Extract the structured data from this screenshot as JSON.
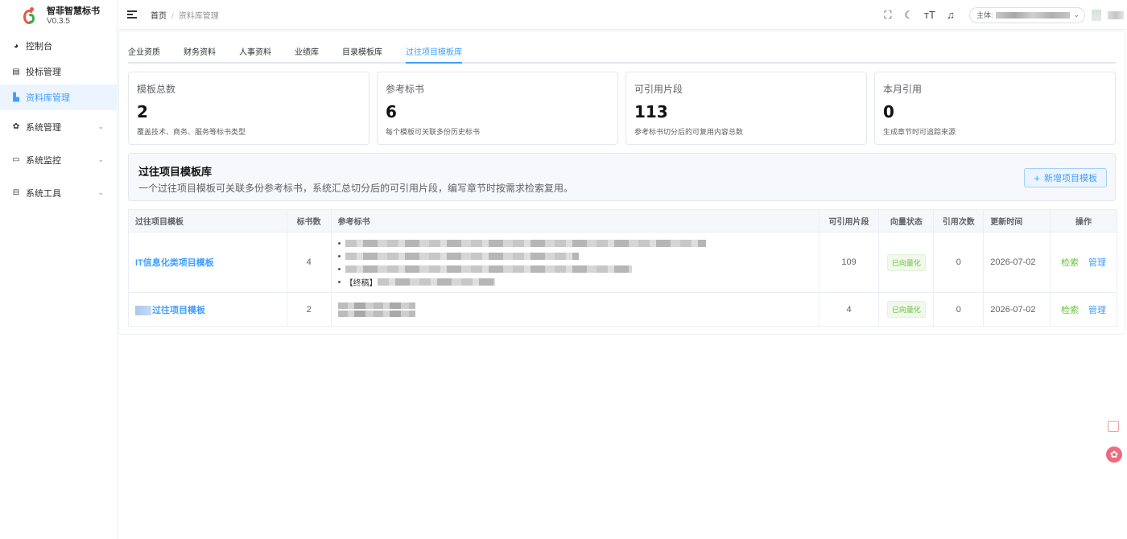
{
  "brand": {
    "name": "智菲智慧标书",
    "version": "V0.3.5"
  },
  "sidebar": {
    "items": [
      {
        "label": "控制台",
        "icon": "dashboard-icon"
      },
      {
        "label": "投标管理",
        "icon": "document-icon"
      },
      {
        "label": "资料库管理",
        "icon": "library-icon",
        "active": true
      },
      {
        "label": "系统管理",
        "icon": "gear-icon"
      },
      {
        "label": "系统监控",
        "icon": "monitor-icon"
      },
      {
        "label": "系统工具",
        "icon": "toolbox-icon"
      }
    ]
  },
  "breadcrumb": {
    "home": "首页",
    "separator": "/",
    "current": "资料库管理"
  },
  "topbar": {
    "entity_label": "主体:"
  },
  "tabs": [
    "企业资质",
    "财务资料",
    "人事资料",
    "业绩库",
    "目录模板库",
    "过往项目模板库"
  ],
  "stats": [
    {
      "label": "模板总数",
      "value": "2",
      "desc": "覆盖技术、商务、服务等标书类型"
    },
    {
      "label": "参考标书",
      "value": "6",
      "desc": "每个模板可关联多份历史标书"
    },
    {
      "label": "可引用片段",
      "value": "113",
      "desc": "参考标书切分后的可复用内容总数"
    },
    {
      "label": "本月引用",
      "value": "0",
      "desc": "生成章节时可追踪来源"
    }
  ],
  "banner": {
    "title": "过往项目模板库",
    "subtitle": "一个过往项目模板可关联多份参考标书，系统汇总切分后的可引用片段，编写章节时按需求检索复用。",
    "add_button": "新增项目模板"
  },
  "table": {
    "headers": [
      "过往项目模板",
      "标书数",
      "参考标书",
      "可引用片段",
      "向量状态",
      "引用次数",
      "更新时间",
      "操作"
    ],
    "rows": [
      {
        "name": "IT信息化类项目模板",
        "count": "4",
        "ref_prefix": "【终稿】",
        "fragments": "109",
        "status": "已向量化",
        "citations": "0",
        "updated": "2026-07-02",
        "action_search": "检索",
        "action_manage": "管理"
      },
      {
        "name": "过往项目模板",
        "count": "2",
        "fragments": "4",
        "status": "已向量化",
        "citations": "0",
        "updated": "2026-07-02",
        "action_search": "检索",
        "action_manage": "管理"
      }
    ]
  },
  "colors": {
    "accent": "#409eff",
    "success": "#67c23a",
    "active_bg": "#ecf5ff"
  }
}
